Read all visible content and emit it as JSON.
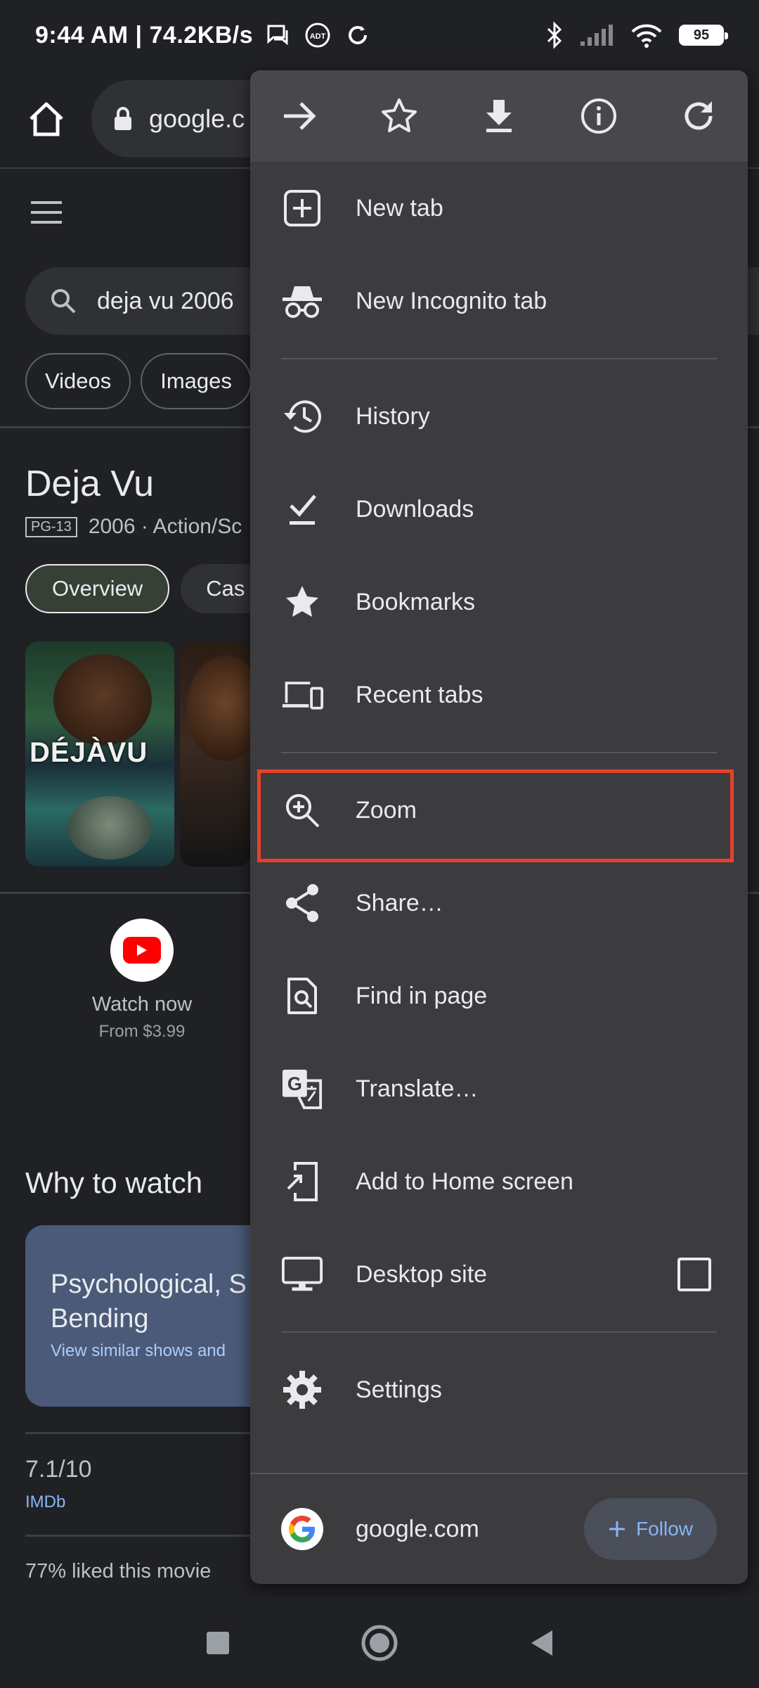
{
  "status_bar": {
    "time_speed": "9:44 AM | 74.2KB/s",
    "battery": "95"
  },
  "browser": {
    "url_text": "google.c"
  },
  "page": {
    "search_query": "deja vu 2006",
    "chips": [
      "Videos",
      "Images"
    ],
    "movie_title": "Deja Vu",
    "rating": "PG-13",
    "meta": "2006 · Action/Sc",
    "tab_active": "Overview",
    "tab_other": "Cas",
    "poster_word": "DÉJÀVU",
    "watch_label": "Watch now",
    "watch_price": "From $3.99",
    "why_heading": "Why to watch",
    "reason_title": "Psychological, S Mind Bending",
    "reason_sub": "View similar shows and",
    "score": "7.1/10",
    "score_source": "IMDb",
    "liked": "77% liked this movie"
  },
  "menu": {
    "top_actions": [
      "forward",
      "bookmark",
      "download",
      "page-info",
      "refresh"
    ],
    "items": [
      {
        "label": "New tab",
        "icon": "new-tab-icon"
      },
      {
        "label": "New Incognito tab",
        "icon": "incognito-icon"
      },
      {
        "label": "History",
        "icon": "history-icon"
      },
      {
        "label": "Downloads",
        "icon": "downloads-icon"
      },
      {
        "label": "Bookmarks",
        "icon": "star-icon"
      },
      {
        "label": "Recent tabs",
        "icon": "devices-icon"
      },
      {
        "label": "Zoom",
        "icon": "zoom-icon"
      },
      {
        "label": "Share…",
        "icon": "share-icon"
      },
      {
        "label": "Find in page",
        "icon": "find-icon"
      },
      {
        "label": "Translate…",
        "icon": "translate-icon"
      },
      {
        "label": "Add to Home screen",
        "icon": "add-home-icon"
      },
      {
        "label": "Desktop site",
        "icon": "desktop-icon"
      },
      {
        "label": "Settings",
        "icon": "gear-icon"
      }
    ],
    "site": "google.com",
    "follow_label": "Follow"
  },
  "colors": {
    "highlight": "#e8402a",
    "menu_bg": "#3c3c3e",
    "follow_text": "#8ab4f8"
  }
}
